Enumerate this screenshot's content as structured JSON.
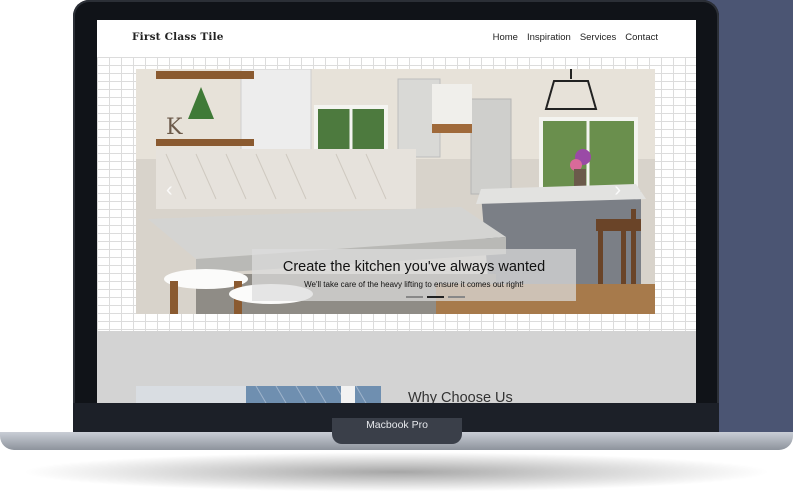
{
  "device": {
    "label": "Macbook Pro",
    "colors": {
      "frame": "#101318",
      "backdrop": "#4b5573",
      "base": "#aeb4bd"
    }
  },
  "site": {
    "brand": "First Class Tile",
    "nav": [
      "Home",
      "Inspiration",
      "Services",
      "Contact"
    ]
  },
  "carousel": {
    "title": "Create the kitchen you've always wanted",
    "subtitle": "We'll take care of the heavy lifting to ensure it comes out right!",
    "prev_icon": "chevron-left-icon",
    "next_icon": "chevron-right-icon",
    "slide_count": 3,
    "active_slide": 2
  },
  "section": {
    "heading": "Why Choose Us"
  }
}
